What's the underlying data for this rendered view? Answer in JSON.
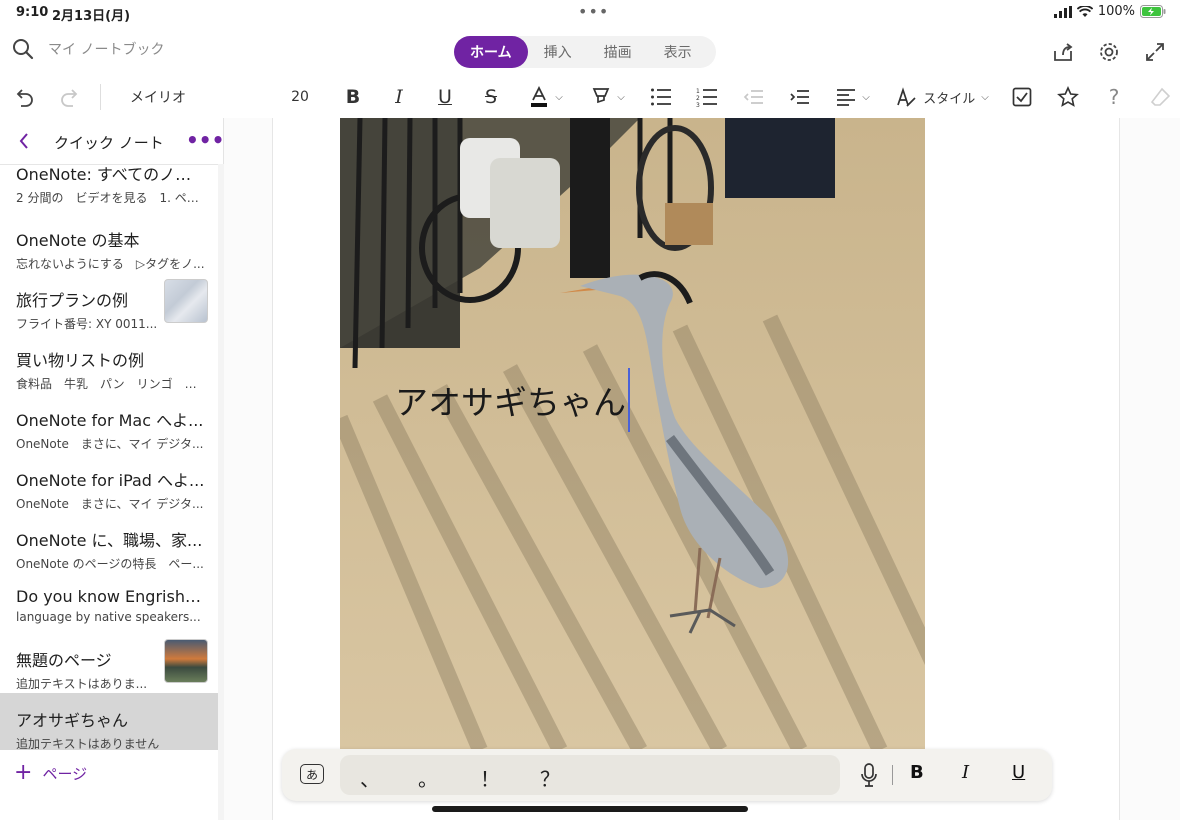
{
  "status_bar": {
    "time": "9:10",
    "date": "2月13日(月)",
    "battery": "100%"
  },
  "search": {
    "placeholder": "マイ ノートブック"
  },
  "tabs": [
    {
      "label": "ホーム",
      "active": true
    },
    {
      "label": "挿入",
      "active": false
    },
    {
      "label": "描画",
      "active": false
    },
    {
      "label": "表示",
      "active": false
    }
  ],
  "ribbon": {
    "font_name": "メイリオ",
    "font_size": "20",
    "style_label": "スタイル"
  },
  "sidebar": {
    "section_title": "クイック ノート",
    "add_page_label": "ページ",
    "pages": [
      {
        "title": "OneNote: すべてのノート...",
        "snippet": "2 分間の　ビデオを見る　1. ペー..."
      },
      {
        "title": "OneNote の基本",
        "snippet": "忘れないようにする　▷タグをノ..."
      },
      {
        "title": "旅行プランの例",
        "snippet": "フライト番号: XY 0011...",
        "thumbnail": "map"
      },
      {
        "title": "買い物リストの例",
        "snippet": "食料品　牛乳　パン　リンゴ　チョ..."
      },
      {
        "title": "OneNote for Mac へよ...",
        "snippet": "OneNote　まさに、マイ デジタ..."
      },
      {
        "title": "OneNote for iPad へよ...",
        "snippet": "OneNote　まさに、マイ デジタ..."
      },
      {
        "title": "OneNote に、職場、家...",
        "snippet": "OneNote のページの特長　ペー..."
      },
      {
        "title": "Do you know Engrish?...",
        "snippet": "language by native speakers..."
      },
      {
        "title": "無題のページ",
        "snippet": "追加テキストはありま...",
        "thumbnail": "sunset"
      },
      {
        "title": "アオサギちゃん",
        "snippet": "追加テキストはありません",
        "selected": true
      }
    ]
  },
  "note": {
    "text": "アオサギちゃん"
  },
  "keyboard_bar": {
    "kana": "あ",
    "punctuation": [
      "、",
      "。",
      "！",
      "？"
    ],
    "bold": "B",
    "italic": "I",
    "underline": "U"
  },
  "colors": {
    "accent": "#7023a3",
    "selected_row": "#d6d6d6",
    "caret": "#4a62d8"
  }
}
